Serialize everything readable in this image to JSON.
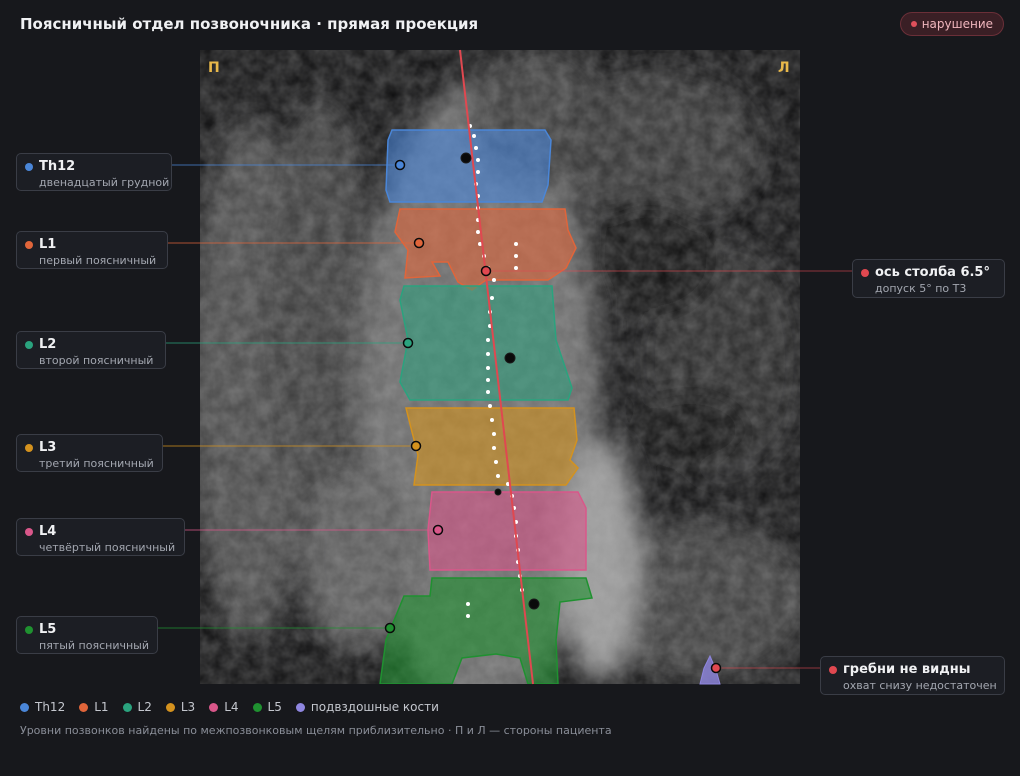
{
  "header": {
    "title": "Поясничный отдел позвоночника · прямая проекция",
    "badge": "нарушение"
  },
  "image": {
    "side_right_patient": "П",
    "side_left_patient": "Л"
  },
  "vertebrae": [
    {
      "id": "Th12",
      "name": "Th12",
      "desc": "двенадцатый грудной",
      "color": "#4a86d8"
    },
    {
      "id": "L1",
      "name": "L1",
      "desc": "первый поясничный",
      "color": "#e0653a"
    },
    {
      "id": "L2",
      "name": "L2",
      "desc": "второй поясничный",
      "color": "#2aa37e"
    },
    {
      "id": "L3",
      "name": "L3",
      "desc": "третий поясничный",
      "color": "#d4921e"
    },
    {
      "id": "L4",
      "name": "L4",
      "desc": "четвёртый поясничный",
      "color": "#d9578a"
    },
    {
      "id": "L5",
      "name": "L5",
      "desc": "пятый поясничный",
      "color": "#1f9130"
    }
  ],
  "findings": {
    "axis": {
      "name": "ось столба 6.5°",
      "desc": "допуск 5° по Т3",
      "color": "#e04850"
    },
    "crests": {
      "name": "гребни не видны",
      "desc": "охват снизу недостаточен",
      "color": "#e04850"
    }
  },
  "legend": [
    {
      "label": "Th12",
      "color": "#4a86d8"
    },
    {
      "label": "L1",
      "color": "#e0653a"
    },
    {
      "label": "L2",
      "color": "#2aa37e"
    },
    {
      "label": "L3",
      "color": "#d4921e"
    },
    {
      "label": "L4",
      "color": "#d9578a"
    },
    {
      "label": "L5",
      "color": "#1f9130"
    },
    {
      "label": "подвздошные кости",
      "color": "#8f86e0"
    }
  ],
  "footnote": "Уровни позвонков найдены по межпозвонковым щелям приблизительно · П и Л — стороны пациента"
}
